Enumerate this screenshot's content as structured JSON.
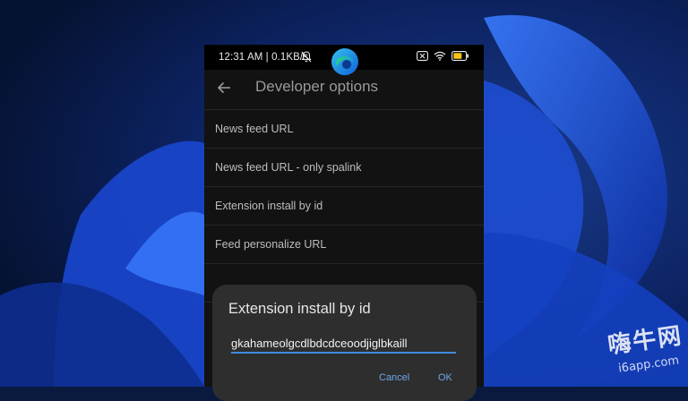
{
  "status_bar": {
    "time_speed": "12:31 AM | 0.1KB/s",
    "icons": [
      "bell-off-icon",
      "close-box-icon",
      "wifi-icon",
      "battery-icon"
    ]
  },
  "app": {
    "logo": "edge-logo",
    "title": "Developer options",
    "back_icon": "back-arrow-icon"
  },
  "list_items": [
    "News feed URL",
    "News feed URL - only spalink",
    "Extension install by id",
    "Feed personalize URL"
  ],
  "dialog": {
    "title": "Extension install by id",
    "input_value": "gkahameolgcdlbdcdceoodjiglbkaill",
    "cancel_label": "Cancel",
    "ok_label": "OK"
  },
  "watermark": {
    "text": "嗨牛网",
    "url": "i6app.com"
  },
  "colors": {
    "accent": "#3d8de0",
    "dialog_bg": "#2e2e2e",
    "phone_bg": "#121212",
    "wallpaper": "#0a1a3e"
  }
}
